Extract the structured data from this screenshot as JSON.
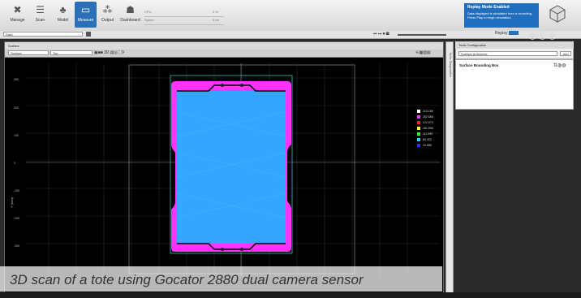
{
  "toolbar": {
    "buttons": [
      {
        "label": "Manage",
        "icon": "wrench-icon",
        "glyph": "✖"
      },
      {
        "label": "Scan",
        "icon": "scan-icon",
        "glyph": "☰"
      },
      {
        "label": "Model",
        "icon": "model-icon",
        "glyph": "♣"
      },
      {
        "label": "Measure",
        "icon": "measure-icon",
        "glyph": "▭"
      },
      {
        "label": "Output",
        "icon": "output-icon",
        "glyph": "⁂"
      },
      {
        "label": "Dashboard",
        "icon": "dashboard-icon",
        "glyph": "☗"
      }
    ],
    "cpu_label": "CPU",
    "cpu_value": "0 %",
    "speed_label": "Speed",
    "speed_value": "0 Hz"
  },
  "replay_banner": {
    "title": "Replay Mode Enabled",
    "text": "Data displayed is simulated from a recording. Press Play to begin simulation."
  },
  "subbar": {
    "left_select": "Data",
    "replay_label": "Replay"
  },
  "data_panel": {
    "title": "Surface",
    "source_select": "Surface",
    "view_select": "Top",
    "yaxis_title": "Y (mm)",
    "y_ticks": [
      "250",
      "200",
      "150",
      "0",
      "-150",
      "-200",
      "-250"
    ]
  },
  "legend": {
    "items": [
      {
        "value": "313.186",
        "color": "#ffffff"
      },
      {
        "value": "262.688",
        "color": "#ff33ff"
      },
      {
        "value": "212.073",
        "color": "#ff2222"
      },
      {
        "value": "161.556",
        "color": "#ffff33"
      },
      {
        "value": "111.059",
        "color": "#33ff33"
      },
      {
        "value": "60.423",
        "color": "#33ccff"
      },
      {
        "value": "10.686",
        "color": "#2233ff"
      }
    ]
  },
  "sidebar_strip_label": "Tools Diagnostics",
  "tools_panel": {
    "title": "Tools Configuration",
    "select": "Surface Arithmetic",
    "add_label": "Add",
    "tool_item": "Surface Bounding Box"
  },
  "caption": "3D scan of a tote using Gocator 2880 dual camera sensor",
  "colors": {
    "accent": "#2b6fb6",
    "tote_rim": "#ff33ff",
    "tote_fill": "#35a6ff"
  }
}
